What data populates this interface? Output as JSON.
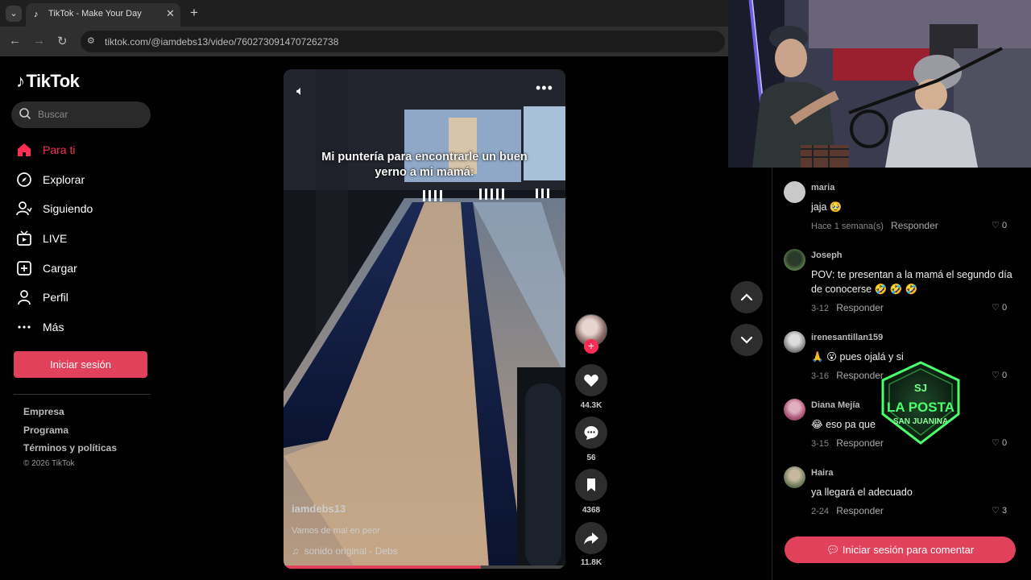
{
  "browser": {
    "tab_title": "TikTok - Make Your Day",
    "url": "tiktok.com/@iamdebs13/video/7602730914707262738"
  },
  "sidebar": {
    "logo_text": "TikTok",
    "search_placeholder": "Buscar",
    "nav": [
      {
        "label": "Para ti",
        "icon": "home-icon",
        "active": true
      },
      {
        "label": "Explorar",
        "icon": "compass-icon"
      },
      {
        "label": "Siguiendo",
        "icon": "following-icon"
      },
      {
        "label": "LIVE",
        "icon": "live-tv-icon"
      },
      {
        "label": "Cargar",
        "icon": "upload-icon"
      },
      {
        "label": "Perfil",
        "icon": "profile-icon"
      },
      {
        "label": "Más",
        "icon": "more-dots-icon"
      }
    ],
    "login_label": "Iniciar sesión",
    "footer": [
      "Empresa",
      "Programa",
      "Términos y políticas"
    ],
    "copyright": "© 2026 TikTok"
  },
  "video": {
    "caption": "Mi puntería para encontrarle un buen yerno a mi mamá:",
    "author": "iamdebs13",
    "description": "Vamos de mal en peor",
    "sound": "sonido original - Debs",
    "progress": 0.7
  },
  "actions": {
    "likes": "44.3K",
    "comments": "56",
    "saves": "4368",
    "shares": "11.8K"
  },
  "comments": {
    "items": [
      {
        "user": "maria",
        "text": "jaja 🥹",
        "date": "Hace 1 semana(s)",
        "reply": "Responder",
        "likes": "0",
        "avatar_color": "#c9c9c9"
      },
      {
        "user": "Joseph",
        "text": "POV: te presentan a la mamá el segundo día de conocerse 🤣 🤣 🤣",
        "date": "3-12",
        "reply": "Responder",
        "likes": "0",
        "avatar_color": "#4a6a3a"
      },
      {
        "user": "irenesantillan159",
        "text": "🙏 😮 pues ojalá y si",
        "date": "3-16",
        "reply": "Responder",
        "likes": "0",
        "avatar_color": "#777777"
      },
      {
        "user": "Diana Mejía",
        "text": "😂 eso pa que",
        "date": "3-15",
        "reply": "Responder",
        "likes": "0",
        "avatar_color": "#b05a7a"
      },
      {
        "user": "Haira",
        "text": "ya llegará el adecuado",
        "date": "2-24",
        "reply": "Responder",
        "likes": "3",
        "avatar_color": "#6a7a5a"
      }
    ],
    "login_label": "Iniciar sesión para comentar"
  },
  "overlay_logo": {
    "top": "SJ",
    "line1": "LA POSTA",
    "line2": "SAN JUANINA"
  },
  "colors": {
    "brand": "#fe2c55",
    "button": "#e2415b",
    "logo_green": "#4cff6a"
  }
}
